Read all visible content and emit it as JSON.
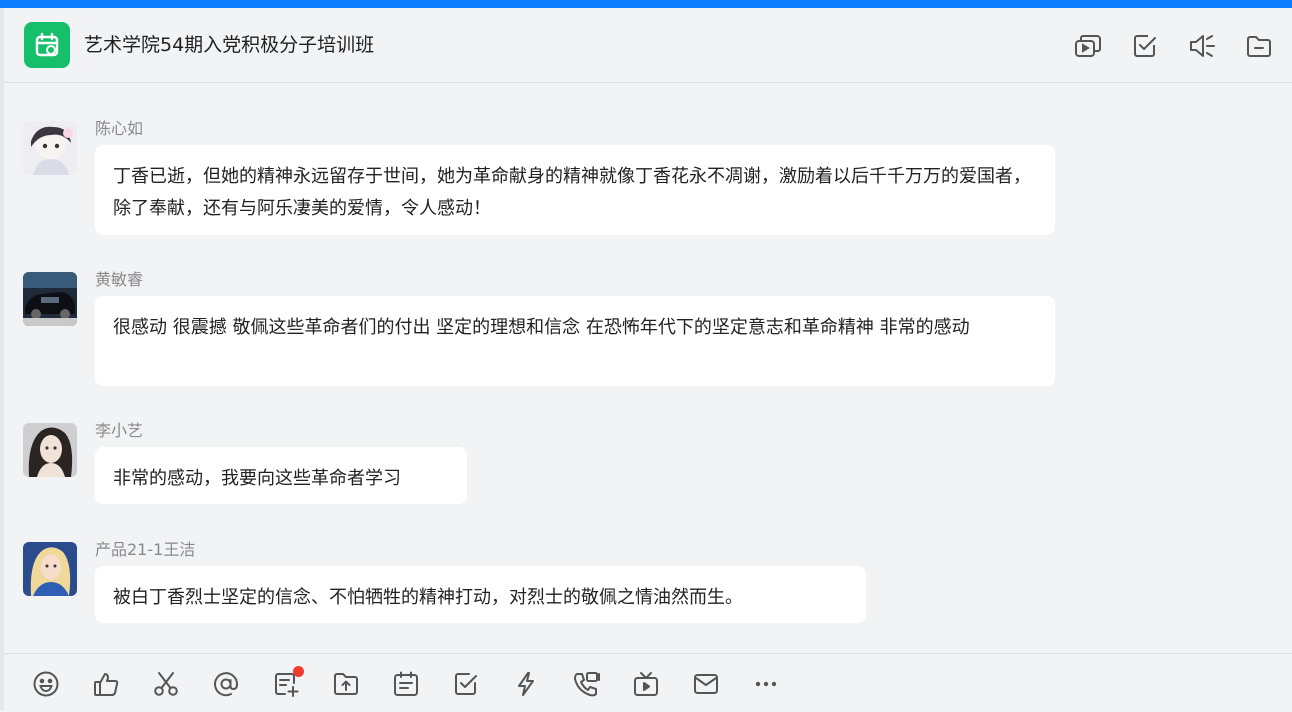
{
  "header": {
    "title": "艺术学院54期入党积极分子培训班",
    "group_icon": "calendar-group-icon",
    "actions": [
      "history-icon",
      "checklist-icon",
      "announce-icon",
      "folder-icon"
    ]
  },
  "messages": [
    {
      "sender": "陈心如",
      "text": "丁香已逝，但她的精神永远留存于世间，她为革命献身的精神就像丁香花永不凋谢，激励着以后千千万万的爱国者，除了奉献，还有与阿乐凄美的爱情，令人感动！"
    },
    {
      "sender": "黄敏睿",
      "text": "很感动 很震撼 敬佩这些革命者们的付出 坚定的理想和信念 在恐怖年代下的坚定意志和革命精神 非常的感动"
    },
    {
      "sender": "李小艺",
      "text": "非常的感动，我要向这些革命者学习"
    },
    {
      "sender": "产品21-1王洁",
      "text": "被白丁香烈士坚定的信念、不怕牺牲的精神打动，对烈士的敬佩之情油然而生。"
    }
  ],
  "composer": {
    "tools": [
      "emoji-icon",
      "thumbs-up-icon",
      "scissors-icon",
      "at-icon",
      "doc-add-icon",
      "upload-icon",
      "schedule-icon",
      "task-icon",
      "lightning-icon",
      "call-icon",
      "live-tv-icon",
      "mail-icon",
      "more-icon"
    ],
    "colors": {
      "accent": "#0a7cff",
      "group_icon_bg": "#16c06a",
      "notification_dot": "#f23a2f"
    }
  }
}
